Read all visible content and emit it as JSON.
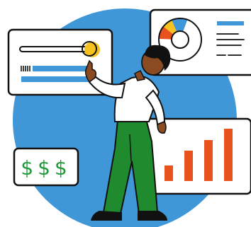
{
  "illustration": {
    "dollar_card": {
      "text": "$$$"
    },
    "bar_chart": {
      "values": [
        0.22,
        0.43,
        0.58,
        0.74
      ],
      "bar_color": "#e8521c"
    },
    "donut_chart": {
      "slices": [
        {
          "share": 0.7,
          "color": "#ffffff"
        },
        {
          "share": 0.1,
          "color": "#e8521c"
        },
        {
          "share": 0.08,
          "color": "#f7c21d"
        },
        {
          "share": 0.12,
          "color": "#3f97d8"
        }
      ]
    },
    "progress_slider": {
      "value": 0.72
    },
    "colors": {
      "blue_backdrop": "#3f97d8",
      "outline": "#111111",
      "card": "#ffffff",
      "accent_blue": "#3f97d8",
      "orange": "#e8521c",
      "yellow": "#f7c21d",
      "green_text": "#1f9b3a",
      "pants": "#1f8a2e",
      "skin": "#8a4a22",
      "hair": "#111111",
      "shirt": "#ffffff"
    }
  }
}
